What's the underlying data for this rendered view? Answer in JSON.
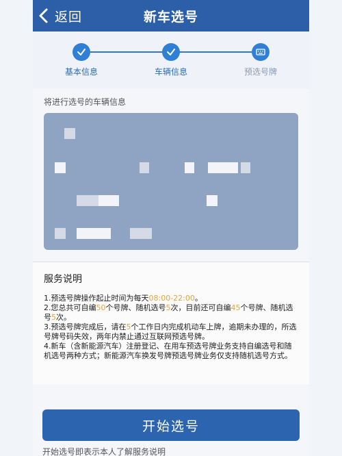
{
  "header": {
    "back_label": "返回",
    "title": "新车选号"
  },
  "steps": [
    {
      "label": "基本信息",
      "state": "done"
    },
    {
      "label": "车辆信息",
      "state": "done"
    },
    {
      "label": "预选号牌",
      "state": "current"
    }
  ],
  "vehicle_section_label": "将进行选号的车辆信息",
  "notes": {
    "title": "服务说明",
    "items": [
      [
        "1.预选号牌操作起止时间为每天",
        "08:00-22:00",
        "。"
      ],
      [
        "2.您总共可自编",
        "50",
        "个号牌、随机选号",
        "5",
        "次，目前还可自编",
        "45",
        "个号牌、随机选号",
        "5",
        "次。"
      ],
      [
        "3.预选号牌完成后，请在",
        "5",
        "个工作日内完成机动车上牌，逾期未办理的，所选号牌号码失效，两年内禁止通过互联网预选号牌。"
      ],
      [
        "4.新车（含新能源汽车）注册登记、在用车预选号牌业务支持自编选号和随机选号两种方式；新能源汽车换发号牌预选号牌业务仅支持随机选号方式。"
      ]
    ],
    "highlight_color": "#e8a33a"
  },
  "start_button_label": "开始选号",
  "footer_note": "开始选号即表示本人了解服务说明"
}
